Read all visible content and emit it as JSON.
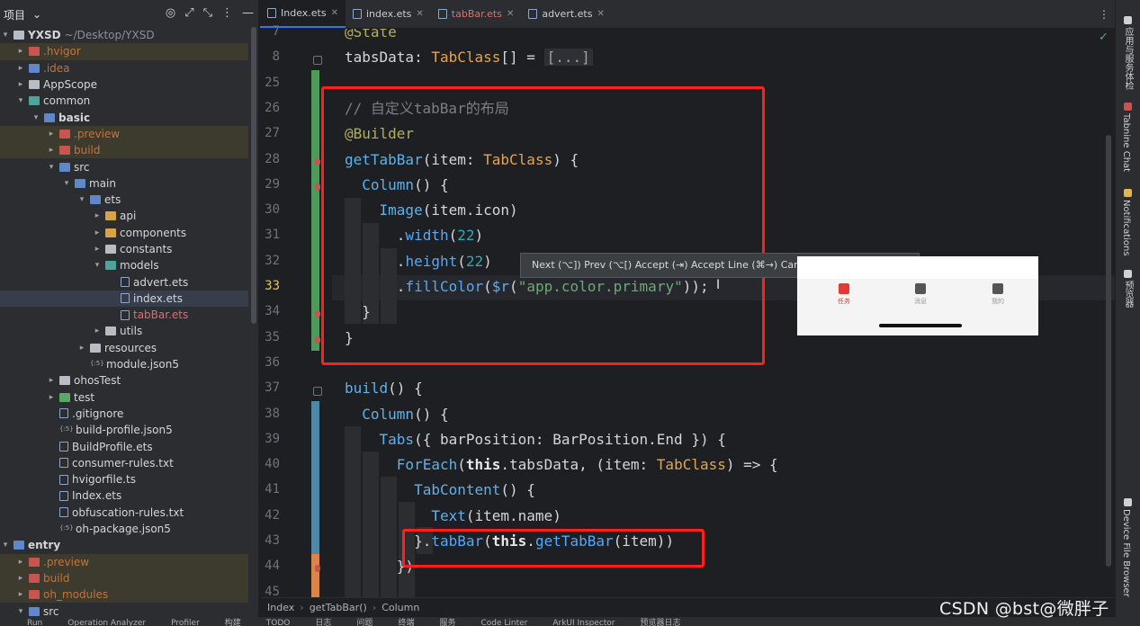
{
  "project_panel": {
    "title": "项目",
    "tree": [
      {
        "label": "YXSD",
        "extra": "~/Desktop/YXSD",
        "depth": 0,
        "arrow": "▾",
        "icon": "folder",
        "bold": true
      },
      {
        "label": ".hvigor",
        "depth": 1,
        "arrow": "▸",
        "icon": "red",
        "style": "muted",
        "hl": true
      },
      {
        "label": ".idea",
        "depth": 1,
        "arrow": "▸",
        "icon": "blue",
        "style": "muted"
      },
      {
        "label": "AppScope",
        "depth": 1,
        "arrow": "▸",
        "icon": "folder"
      },
      {
        "label": "common",
        "depth": 1,
        "arrow": "▾",
        "icon": "teal"
      },
      {
        "label": "basic",
        "depth": 2,
        "arrow": "▾",
        "icon": "blue",
        "bold": true
      },
      {
        "label": ".preview",
        "depth": 3,
        "arrow": "▸",
        "icon": "red",
        "style": "muted",
        "hl": true
      },
      {
        "label": "build",
        "depth": 3,
        "arrow": "▸",
        "icon": "red",
        "style": "muted",
        "hl": true
      },
      {
        "label": "src",
        "depth": 3,
        "arrow": "▾",
        "icon": "blue"
      },
      {
        "label": "main",
        "depth": 4,
        "arrow": "▾",
        "icon": "blue"
      },
      {
        "label": "ets",
        "depth": 5,
        "arrow": "▾",
        "icon": "blue"
      },
      {
        "label": "api",
        "depth": 6,
        "arrow": "▸",
        "icon": "yellow"
      },
      {
        "label": "components",
        "depth": 6,
        "arrow": "▸",
        "icon": "yellow"
      },
      {
        "label": "constants",
        "depth": 6,
        "arrow": "▸",
        "icon": "folder"
      },
      {
        "label": "models",
        "depth": 6,
        "arrow": "▾",
        "icon": "teal"
      },
      {
        "label": "advert.ets",
        "depth": 7,
        "arrow": "",
        "icon": "file"
      },
      {
        "label": "index.ets",
        "depth": 7,
        "arrow": "",
        "icon": "file",
        "sel": true
      },
      {
        "label": "tabBar.ets",
        "depth": 7,
        "arrow": "",
        "icon": "file",
        "style": "redtxt"
      },
      {
        "label": "utils",
        "depth": 6,
        "arrow": "▸",
        "icon": "folder"
      },
      {
        "label": "resources",
        "depth": 5,
        "arrow": "▸",
        "icon": "folder"
      },
      {
        "label": "module.json5",
        "depth": 5,
        "arrow": "",
        "icon": "json"
      },
      {
        "label": "ohosTest",
        "depth": 3,
        "arrow": "▸",
        "icon": "folder"
      },
      {
        "label": "test",
        "depth": 3,
        "arrow": "▸",
        "icon": "green"
      },
      {
        "label": ".gitignore",
        "depth": 3,
        "arrow": "",
        "icon": "file"
      },
      {
        "label": "build-profile.json5",
        "depth": 3,
        "arrow": "",
        "icon": "json"
      },
      {
        "label": "BuildProfile.ets",
        "depth": 3,
        "arrow": "",
        "icon": "file"
      },
      {
        "label": "consumer-rules.txt",
        "depth": 3,
        "arrow": "",
        "icon": "file"
      },
      {
        "label": "hvigorfile.ts",
        "depth": 3,
        "arrow": "",
        "icon": "file"
      },
      {
        "label": "Index.ets",
        "depth": 3,
        "arrow": "",
        "icon": "file"
      },
      {
        "label": "obfuscation-rules.txt",
        "depth": 3,
        "arrow": "",
        "icon": "file"
      },
      {
        "label": "oh-package.json5",
        "depth": 3,
        "arrow": "",
        "icon": "json"
      },
      {
        "label": "entry",
        "depth": 0,
        "arrow": "▾",
        "icon": "blue",
        "bold": true
      },
      {
        "label": ".preview",
        "depth": 1,
        "arrow": "▸",
        "icon": "red",
        "style": "muted",
        "hl": true
      },
      {
        "label": "build",
        "depth": 1,
        "arrow": "▸",
        "icon": "red",
        "style": "muted",
        "hl": true
      },
      {
        "label": "oh_modules",
        "depth": 1,
        "arrow": "▸",
        "icon": "red",
        "style": "muted",
        "hl": true
      },
      {
        "label": "src",
        "depth": 1,
        "arrow": "▾",
        "icon": "blue"
      }
    ]
  },
  "tabs": [
    {
      "label": "Index.ets",
      "active": true,
      "red": false
    },
    {
      "label": "index.ets",
      "active": false,
      "red": false
    },
    {
      "label": "tabBar.ets",
      "active": false,
      "red": true
    },
    {
      "label": "advert.ets",
      "active": false,
      "red": false
    }
  ],
  "gutter": {
    "line_numbers": [
      "7",
      "8",
      "25",
      "26",
      "27",
      "28",
      "29",
      "30",
      "31",
      "32",
      "33",
      "34",
      "35",
      "36",
      "37",
      "38",
      "39",
      "40",
      "41",
      "42",
      "43",
      "44",
      "45"
    ],
    "current_line": "33"
  },
  "code_lines": [
    [
      {
        "t": "@State",
        "c": "k-ann"
      }
    ],
    [
      {
        "t": "tabsData",
        "c": ""
      },
      {
        "t": ": ",
        "c": ""
      },
      {
        "t": "TabClass",
        "c": "k-type"
      },
      {
        "t": "[] = ",
        "c": ""
      },
      {
        "t": "[...]",
        "c": "k-fold"
      }
    ],
    [],
    [
      {
        "t": "// 自定义tabBar的布局",
        "c": "k-cmt"
      }
    ],
    [
      {
        "t": "@Builder",
        "c": "k-ann"
      }
    ],
    [
      {
        "t": "getTabBar",
        "c": "k-fn"
      },
      {
        "t": "(item: ",
        "c": ""
      },
      {
        "t": "TabClass",
        "c": "k-type"
      },
      {
        "t": ") {",
        "c": ""
      }
    ],
    [
      {
        "t": "  Column",
        "c": "k-fn"
      },
      {
        "t": "() {",
        "c": ""
      }
    ],
    [
      {
        "t": "    Image",
        "c": "k-fn"
      },
      {
        "t": "(item.icon)",
        "c": ""
      }
    ],
    [
      {
        "t": "      .",
        "c": ""
      },
      {
        "t": "width",
        "c": "k-mth"
      },
      {
        "t": "(",
        "c": ""
      },
      {
        "t": "22",
        "c": "k-num"
      },
      {
        "t": ")",
        "c": ""
      }
    ],
    [
      {
        "t": "      .",
        "c": ""
      },
      {
        "t": "height",
        "c": "k-mth"
      },
      {
        "t": "(",
        "c": ""
      },
      {
        "t": "22",
        "c": "k-num"
      },
      {
        "t": ")",
        "c": ""
      }
    ],
    [
      {
        "t": "      .",
        "c": ""
      },
      {
        "t": "fillColor",
        "c": "k-mth"
      },
      {
        "t": "(",
        "c": ""
      },
      {
        "t": "$r",
        "c": "k-fn"
      },
      {
        "t": "(",
        "c": ""
      },
      {
        "t": "\"app.color.primary\"",
        "c": "k-str"
      },
      {
        "t": "));",
        "c": ""
      }
    ],
    [
      {
        "t": "  }",
        "c": ""
      }
    ],
    [
      {
        "t": "}",
        "c": ""
      }
    ],
    [],
    [
      {
        "t": "build",
        "c": "k-fn"
      },
      {
        "t": "() {",
        "c": ""
      }
    ],
    [
      {
        "t": "  Column",
        "c": "k-fn"
      },
      {
        "t": "() {",
        "c": ""
      }
    ],
    [
      {
        "t": "    Tabs",
        "c": "k-fn"
      },
      {
        "t": "({ barPosition: BarPosition.End }) {",
        "c": ""
      }
    ],
    [
      {
        "t": "      ForEach",
        "c": "k-fn"
      },
      {
        "t": "(",
        "c": ""
      },
      {
        "t": "this",
        "c": "k-this"
      },
      {
        "t": ".tabsData, (item: ",
        "c": ""
      },
      {
        "t": "TabClass",
        "c": "k-type"
      },
      {
        "t": ") => {",
        "c": ""
      }
    ],
    [
      {
        "t": "        TabContent",
        "c": "k-fn"
      },
      {
        "t": "() {",
        "c": ""
      }
    ],
    [
      {
        "t": "          Text",
        "c": "k-fn"
      },
      {
        "t": "(item.name)",
        "c": ""
      }
    ],
    [
      {
        "t": "        }.",
        "c": ""
      },
      {
        "t": "tabBar",
        "c": "k-mth"
      },
      {
        "t": "(",
        "c": ""
      },
      {
        "t": "this",
        "c": "k-this"
      },
      {
        "t": ".",
        "c": ""
      },
      {
        "t": "getTabBar",
        "c": "k-mth"
      },
      {
        "t": "(item))",
        "c": ""
      }
    ],
    [
      {
        "t": "      })",
        "c": ""
      }
    ],
    []
  ],
  "suggestion_popup": {
    "text": "Next (⌥]) Prev (⌥[) Accept (⇥) Accept Line (⌘→) Cancel"
  },
  "preview": {
    "tabs": [
      {
        "label": "任务",
        "active": true
      },
      {
        "label": "消息",
        "active": false
      },
      {
        "label": "我的",
        "active": false
      }
    ]
  },
  "right_tools": [
    {
      "label": "应用与服务体检",
      "icon": "health-check-icon"
    },
    {
      "label": "Tabnine Chat",
      "icon": "tabnine-icon"
    },
    {
      "label": "Notifications",
      "icon": "bell-icon"
    },
    {
      "label": "预览器",
      "icon": "previewer-icon"
    },
    {
      "label": "Device File Browser",
      "icon": "device-icon"
    }
  ],
  "breadcrumb": [
    "Index",
    "getTabBar()",
    "Column"
  ],
  "bottom_tools": [
    "Run",
    "Operation Analyzer",
    "Profiler",
    "构建",
    "TODO",
    "日志",
    "问题",
    "终端",
    "服务",
    "Code Linter",
    "ArkUI Inspector",
    "预览器日志"
  ],
  "watermark": "CSDN @bst@微胖子",
  "colors": {
    "accent": "#3574f0",
    "annotation_red": "#ff1f1f",
    "preview_active": "#e53935"
  }
}
